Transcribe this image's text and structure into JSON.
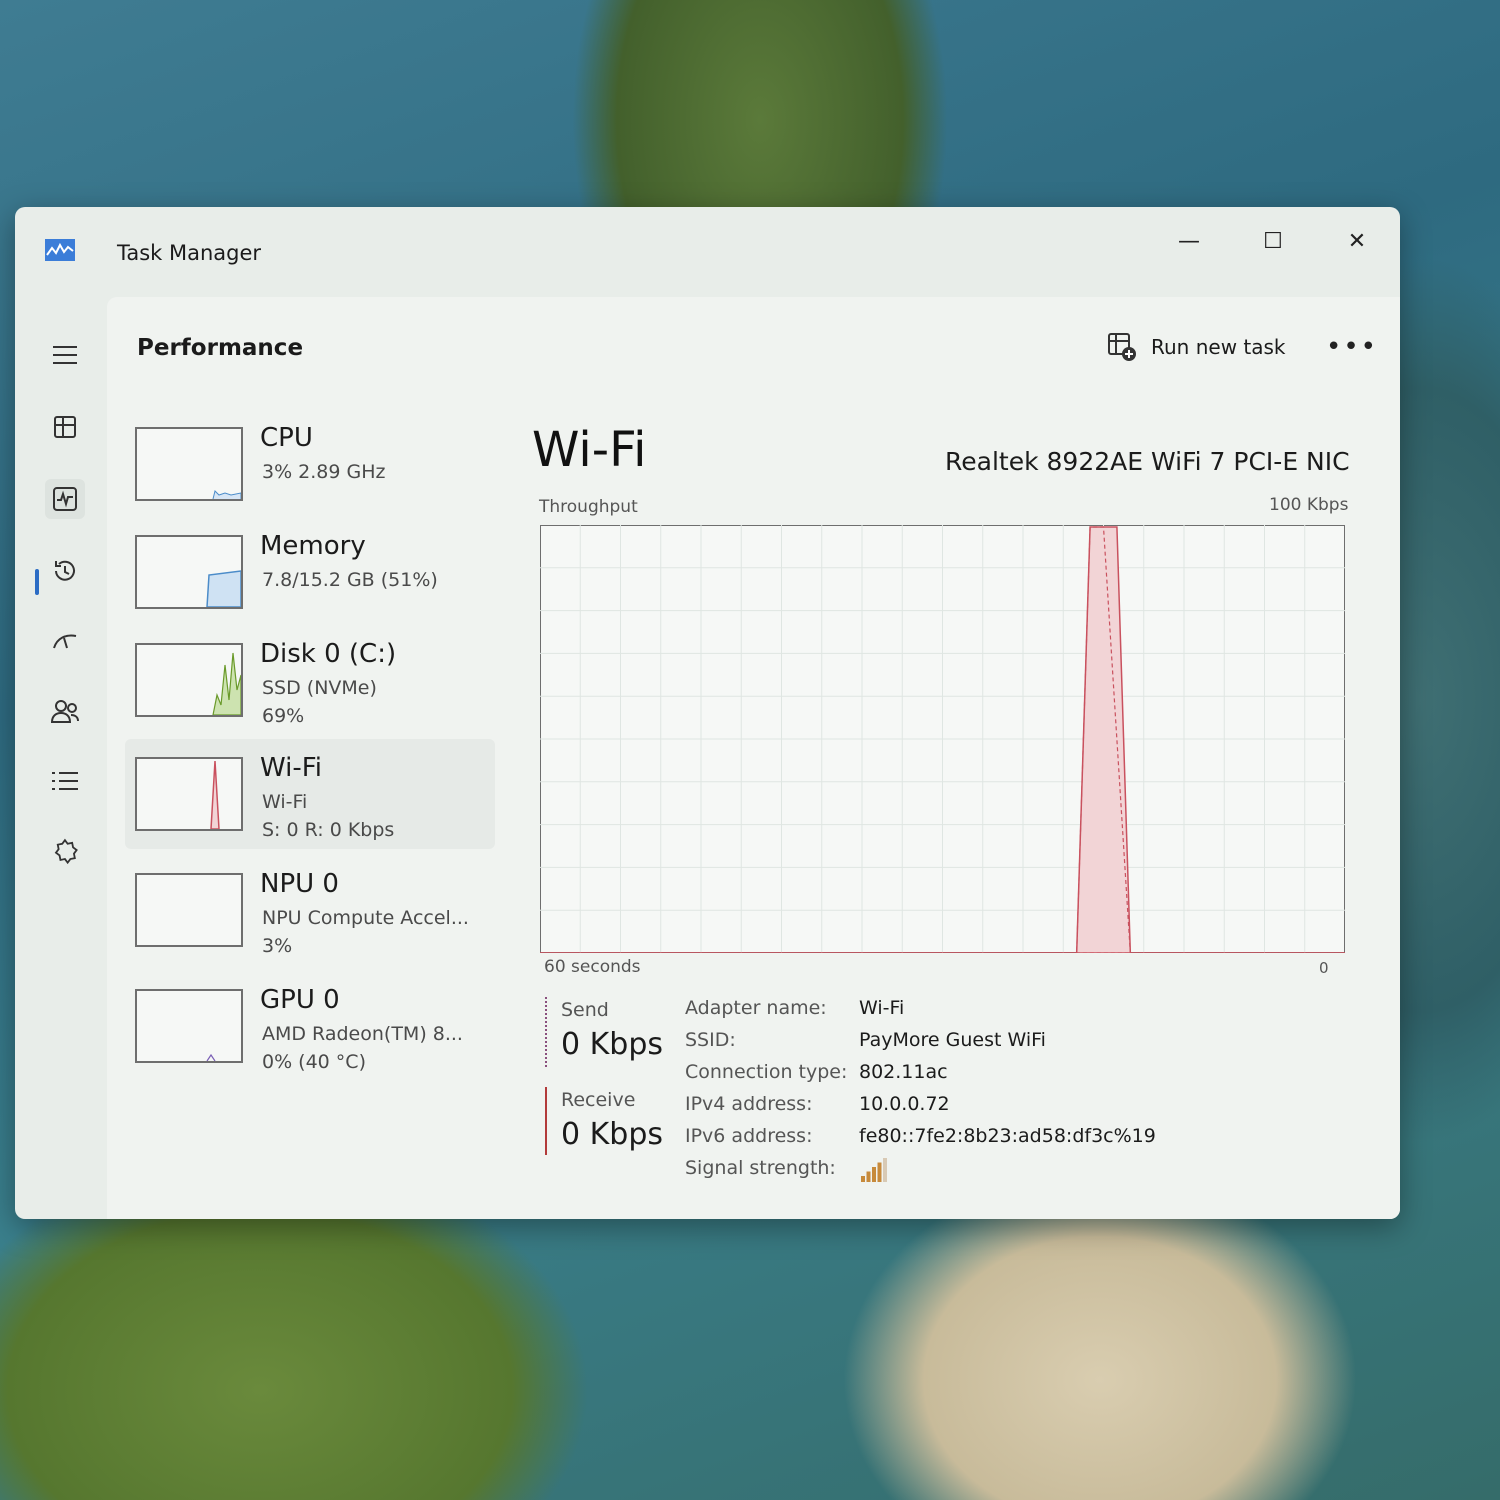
{
  "window": {
    "title": "Task Manager",
    "minimize_glyph": "—",
    "maximize_glyph": "☐",
    "close_glyph": "✕"
  },
  "nav": {
    "items": [
      {
        "icon": "hamburger-menu-icon"
      },
      {
        "icon": "processes-icon"
      },
      {
        "icon": "performance-icon",
        "selected": true
      },
      {
        "icon": "app-history-icon"
      },
      {
        "icon": "startup-apps-icon"
      },
      {
        "icon": "users-icon"
      },
      {
        "icon": "details-icon"
      },
      {
        "icon": "services-icon"
      }
    ],
    "settings_icon": "gear-icon",
    "accent_color": "#2b6cc4"
  },
  "header": {
    "title": "Performance",
    "run_new_task": "Run new task",
    "more": "•••"
  },
  "devices": [
    {
      "name": "CPU",
      "sub": "3%  2.89 GHz",
      "sub2": ""
    },
    {
      "name": "Memory",
      "sub": "7.8/15.2 GB (51%)",
      "sub2": ""
    },
    {
      "name": "Disk 0 (C:)",
      "sub": "SSD (NVMe)",
      "sub2": "69%"
    },
    {
      "name": "Wi-Fi",
      "sub": "Wi-Fi",
      "sub2": "S: 0  R: 0 Kbps",
      "selected": true
    },
    {
      "name": "NPU 0",
      "sub": "NPU Compute Accel...",
      "sub2": "3%"
    },
    {
      "name": "GPU 0",
      "sub": "AMD Radeon(TM) 8...",
      "sub2": "0%  (40 °C)"
    }
  ],
  "detail": {
    "title": "Wi-Fi",
    "adapter": "Realtek 8922AE WiFi 7 PCI-E NIC",
    "throughput_label": "Throughput",
    "max_label": "100 Kbps",
    "x_left": "60 seconds",
    "x_right": "0",
    "send_label": "Send",
    "send_value": "0 Kbps",
    "receive_label": "Receive",
    "receive_value": "0 Kbps",
    "properties": [
      {
        "key": "Adapter name:",
        "value": "Wi-Fi"
      },
      {
        "key": "SSID:",
        "value": "PayMore Guest WiFi"
      },
      {
        "key": "Connection type:",
        "value": "802.11ac"
      },
      {
        "key": "IPv4 address:",
        "value": "10.0.0.72"
      },
      {
        "key": "IPv6 address:",
        "value": "fe80::7fe2:8b23:ad58:df3c%19"
      },
      {
        "key": "Signal strength:",
        "value": ""
      }
    ],
    "signal_bars": 4
  },
  "chart_data": {
    "type": "area",
    "title": "Throughput",
    "xlabel": "60 seconds",
    "ylabel": "",
    "ylim": [
      0,
      100
    ],
    "x": [
      60,
      59,
      58,
      57,
      56,
      55,
      54,
      53,
      52,
      51,
      50,
      49,
      48,
      47,
      46,
      45,
      44,
      43,
      42,
      41,
      40,
      39,
      38,
      37,
      36,
      35,
      34,
      33,
      32,
      31,
      30,
      29,
      28,
      27,
      26,
      25,
      24,
      23,
      22,
      21,
      20,
      19,
      18,
      17,
      16,
      15,
      14,
      13,
      12,
      11,
      10,
      9,
      8,
      7,
      6,
      5,
      4,
      3,
      2,
      1,
      0
    ],
    "series": [
      {
        "name": "Send",
        "values": [
          0,
          0,
          0,
          0,
          0,
          0,
          0,
          0,
          0,
          0,
          0,
          0,
          0,
          0,
          0,
          0,
          0,
          0,
          0,
          0,
          0,
          0,
          0,
          0,
          0,
          0,
          0,
          0,
          0,
          0,
          0,
          0,
          0,
          0,
          0,
          0,
          0,
          0,
          0,
          0,
          0,
          100,
          100,
          100,
          0,
          0,
          0,
          0,
          0,
          0,
          0,
          0,
          0,
          0,
          0,
          0,
          0,
          0,
          0,
          0,
          0
        ]
      },
      {
        "name": "Receive",
        "values": [
          0,
          0,
          0,
          0,
          0,
          0,
          0,
          0,
          0,
          0,
          0,
          0,
          0,
          0,
          0,
          0,
          0,
          0,
          0,
          0,
          0,
          0,
          0,
          0,
          0,
          0,
          0,
          0,
          0,
          0,
          0,
          0,
          0,
          0,
          0,
          0,
          0,
          0,
          0,
          0,
          0,
          100,
          100,
          50,
          0,
          0,
          0,
          0,
          0,
          0,
          0,
          0,
          0,
          0,
          0,
          0,
          0,
          0,
          0,
          0,
          0
        ]
      }
    ],
    "colors": {
      "fill": "#f2d4d6",
      "line": "#c9515e",
      "grid": "#dfe6e2"
    }
  }
}
